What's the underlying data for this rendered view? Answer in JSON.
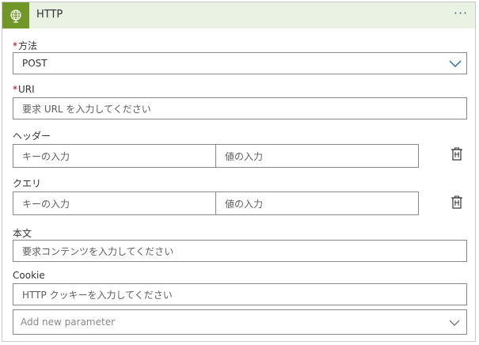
{
  "header": {
    "title": "HTTP",
    "more_label": "···"
  },
  "method": {
    "label": "方法",
    "required_mark": "*",
    "value": "POST"
  },
  "uri": {
    "label": "URI",
    "required_mark": "*",
    "placeholder": "要求 URL を入力してください"
  },
  "headers": {
    "label": "ヘッダー",
    "key_placeholder": "キーの入力",
    "value_placeholder": "値の入力"
  },
  "queries": {
    "label": "クエリ",
    "key_placeholder": "キーの入力",
    "value_placeholder": "値の入力"
  },
  "body": {
    "label": "本文",
    "placeholder": "要求コンテンツを入力してください"
  },
  "cookie": {
    "label": "Cookie",
    "placeholder": "HTTP クッキーを入力してください"
  },
  "add_parameter": {
    "placeholder": "Add new parameter"
  },
  "icons": {
    "action": "globe-icon",
    "dropdown": "chevron-down-icon",
    "delete": "trash-icon"
  },
  "colors": {
    "header_bg": "#eaf2e4",
    "action_icon_bg": "#709727",
    "required": "#a80000",
    "chevron": "#2b6cb0"
  }
}
